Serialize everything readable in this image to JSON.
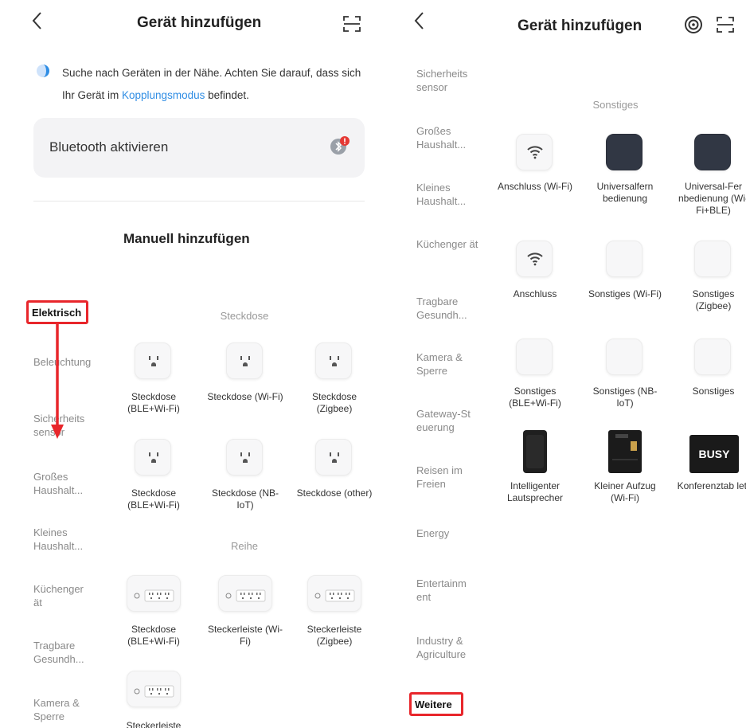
{
  "left": {
    "header": {
      "back_icon": "chevron-left-icon",
      "title": "Gerät hinzufügen",
      "scan_icon": "scan-icon"
    },
    "intro": {
      "text_before": "Suche nach Geräten in der Nähe. Achten Sie darauf, dass sich Ihr Gerät im ",
      "link": "Kopplungsmodus",
      "text_after": " befindet."
    },
    "bluetooth": {
      "label": "Bluetooth aktivieren",
      "icon": "bluetooth-alert-icon"
    },
    "manual_title": "Manuell hinzufügen",
    "categories": [
      "Elektrisch",
      "Beleuchtung",
      "Sicherheits sensor",
      "Großes Haushalt...",
      "Kleines Haushalt...",
      "Küchenger ät",
      "Tragbare Gesundh...",
      "Kamera & Sperre"
    ],
    "sections": [
      {
        "title": "Steckdose",
        "items": [
          {
            "label": "Steckdose (BLE+Wi-Fi)",
            "icon": "socket-icon"
          },
          {
            "label": "Steckdose (Wi-Fi)",
            "icon": "socket-icon"
          },
          {
            "label": "Steckdose (Zigbee)",
            "icon": "socket-icon"
          },
          {
            "label": "Steckdose (BLE+Wi-Fi)",
            "icon": "socket-icon"
          },
          {
            "label": "Steckdose (NB-IoT)",
            "icon": "socket-icon"
          },
          {
            "label": "Steckdose (other)",
            "icon": "socket-icon"
          }
        ]
      },
      {
        "title": "Reihe",
        "items": [
          {
            "label": "Steckdose (BLE+Wi-Fi)",
            "icon": "power-strip-icon"
          },
          {
            "label": "Steckerleiste (Wi-Fi)",
            "icon": "power-strip-icon"
          },
          {
            "label": "Steckerleiste (Zigbee)",
            "icon": "power-strip-icon"
          },
          {
            "label": "Steckerleiste",
            "icon": "power-strip-icon"
          }
        ]
      }
    ]
  },
  "right": {
    "header": {
      "back_icon": "chevron-left-icon",
      "title": "Gerät hinzufügen",
      "target_icon": "target-icon",
      "scan_icon": "scan-icon"
    },
    "categories": [
      "Sicherheits sensor",
      "Großes Haushalt...",
      "Kleines Haushalt...",
      "Küchenger ät",
      "Tragbare Gesundh...",
      "Kamera & Sperre",
      "Gateway-St euerung",
      "Reisen im Freien",
      "Energy",
      "Entertainm ent",
      "Industry & Agriculture",
      "Weitere"
    ],
    "section_title": "Sonstiges",
    "items": [
      {
        "label": "Anschluss (Wi-Fi)",
        "icon": "wifi-icon"
      },
      {
        "label": "Universalfern bedienung",
        "icon": "remote-icon"
      },
      {
        "label": "Universal-Fer nbedienung (Wi-Fi+BLE)",
        "icon": "remote-icon"
      },
      {
        "label": "Anschluss",
        "icon": "wifi-icon"
      },
      {
        "label": "Sonstiges (Wi-Fi)",
        "icon": "generic-device-icon"
      },
      {
        "label": "Sonstiges (Zigbee)",
        "icon": "generic-device-icon"
      },
      {
        "label": "Sonstiges (BLE+Wi-Fi)",
        "icon": "generic-device-icon"
      },
      {
        "label": "Sonstiges (NB-IoT)",
        "icon": "generic-device-icon"
      },
      {
        "label": "Sonstiges",
        "icon": "generic-device-icon"
      },
      {
        "label": "Intelligenter Lautsprecher",
        "icon": "speaker-icon"
      },
      {
        "label": "Kleiner Aufzug (Wi-Fi)",
        "icon": "elevator-icon"
      },
      {
        "label": "Konferenztab lett",
        "icon": "busy-tablet-icon",
        "badge": "BUSY"
      }
    ]
  },
  "colors": {
    "highlight": "#e8262b",
    "link": "#2f8de4",
    "card_bg": "#f3f3f5",
    "alert": "#e53935"
  }
}
